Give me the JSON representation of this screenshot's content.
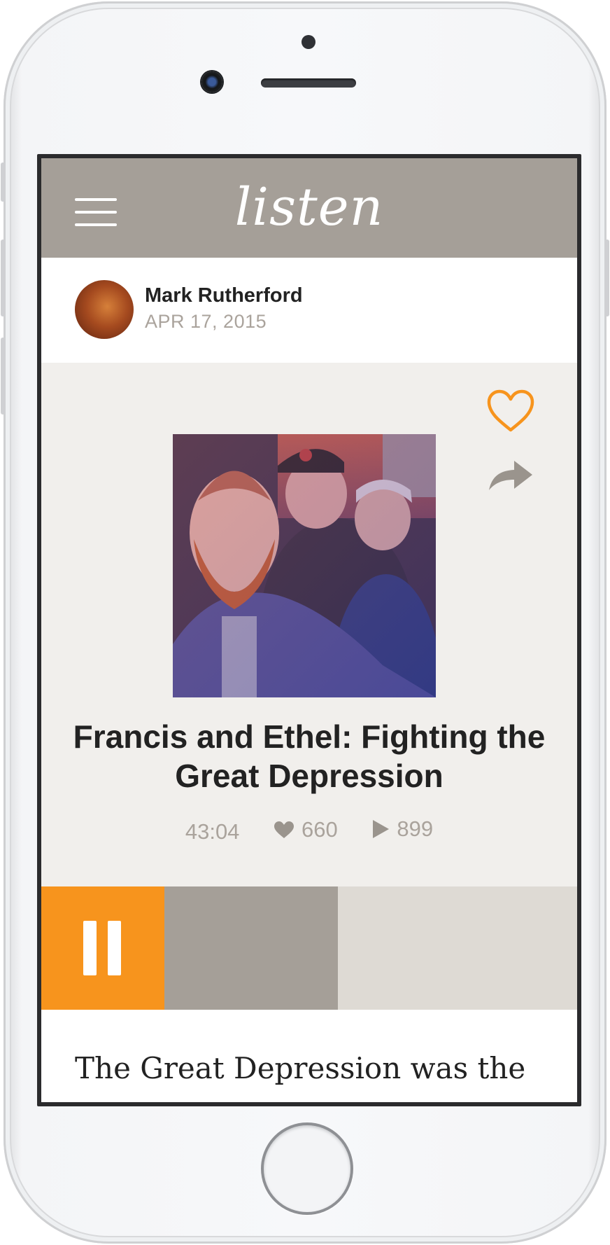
{
  "app": {
    "logo": "listen"
  },
  "author": {
    "name": "Mark Rutherford",
    "date": "APR 17, 2015"
  },
  "story": {
    "title": "Francis and Ethel: Fighting the Great Depression",
    "stats": {
      "duration": "43:04",
      "likes": "660",
      "plays": "899"
    }
  },
  "player": {
    "progress_fraction": 0.42,
    "state": "playing"
  },
  "article": {
    "first_line": "The Great Depression was the"
  },
  "icons": {
    "menu": "hamburger-menu-icon",
    "like": "heart-outline-icon",
    "share": "share-arrow-icon",
    "likes_stat": "heart-filled-icon",
    "plays_stat": "play-triangle-icon",
    "pause": "pause-icon"
  },
  "colors": {
    "header": "#a59f98",
    "accent": "#f7941d",
    "story_bg": "#f1efec",
    "muted_text": "#aaa39c"
  }
}
